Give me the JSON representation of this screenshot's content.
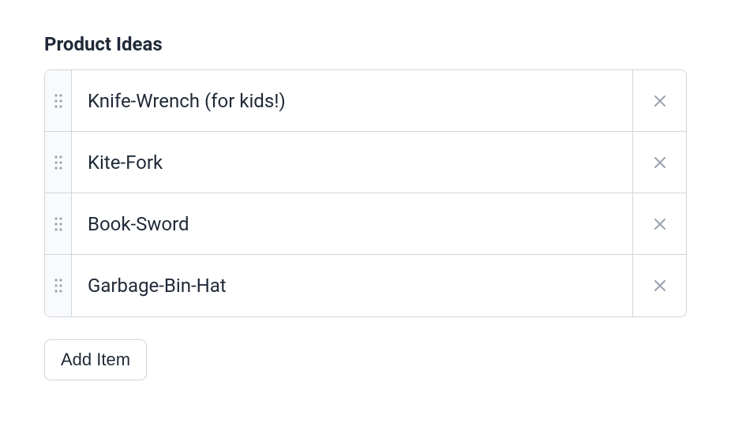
{
  "section": {
    "title": "Product Ideas",
    "items": [
      {
        "label": "Knife-Wrench (for kids!)"
      },
      {
        "label": "Kite-Fork"
      },
      {
        "label": "Book-Sword"
      },
      {
        "label": "Garbage-Bin-Hat"
      }
    ],
    "add_label": "Add Item"
  }
}
